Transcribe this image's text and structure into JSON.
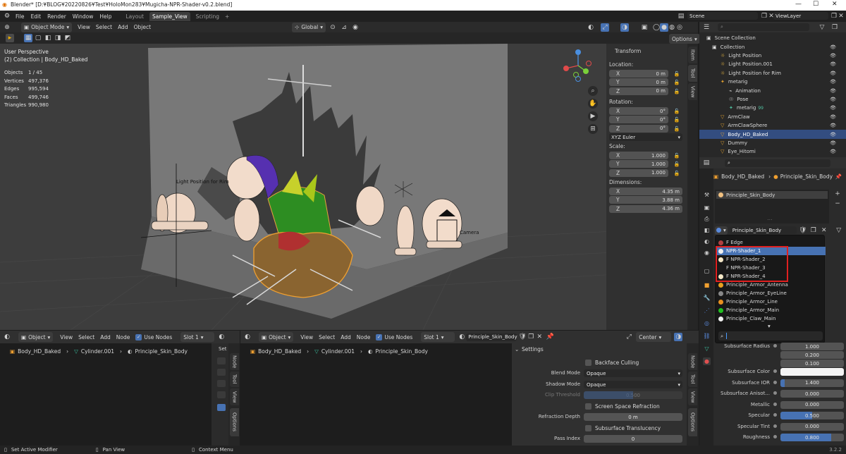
{
  "window": {
    "title": "Blender* [D:¥BLOG¥20220826¥Test¥HoloMon283¥Mugicha-NPR-Shader-v0.2.blend]"
  },
  "menu": [
    "File",
    "Edit",
    "Render",
    "Window",
    "Help"
  ],
  "workspaces": [
    "Layout",
    "Sample_View",
    "Scripting",
    "+"
  ],
  "scene": "Scene",
  "view_layer": "ViewLayer",
  "viewport": {
    "mode": "Object Mode",
    "menus": [
      "View",
      "Select",
      "Add",
      "Object"
    ],
    "transform_orientation": "Global",
    "options": "Options",
    "overlay_text": {
      "view": "User Perspective",
      "collection": "(2) Collection | Body_HD_Baked"
    },
    "stats": {
      "objects_label": "Objects",
      "objects": "1 / 45",
      "vertices_label": "Vertices",
      "vertices": "497,376",
      "edges_label": "Edges",
      "edges": "995,594",
      "faces_label": "Faces",
      "faces": "499,746",
      "triangles_label": "Triangles",
      "triangles": "990,980"
    },
    "labels": {
      "light_rim": "Light Position for Rim",
      "camera": "Camera"
    },
    "tabs": [
      "Item",
      "Tool",
      "View"
    ]
  },
  "npanel": {
    "title": "Transform",
    "location_label": "Location:",
    "location": [
      "0 m",
      "0 m",
      "0 m"
    ],
    "rotation_label": "Rotation:",
    "rotation": [
      "0°",
      "0°",
      "0°"
    ],
    "euler": "XYZ Euler",
    "scale_label": "Scale:",
    "scale": [
      "1.000",
      "1.000",
      "1.000"
    ],
    "dimensions_label": "Dimensions:",
    "dimensions": [
      "4.35 m",
      "3.88 m",
      "4.36 m"
    ],
    "axes": [
      "X",
      "Y",
      "Z"
    ]
  },
  "outliner": {
    "root": "Scene Collection",
    "items": [
      {
        "name": "Collection"
      },
      {
        "name": "Light Position"
      },
      {
        "name": "Light Position.001"
      },
      {
        "name": "Light Position for Rim"
      },
      {
        "name": "metarig"
      },
      {
        "name": "Animation"
      },
      {
        "name": "Pose"
      },
      {
        "name": "metarig",
        "badge": "99"
      },
      {
        "name": "ArmClaw"
      },
      {
        "name": "ArmClawSphere"
      },
      {
        "name": "Body_HD_Baked"
      },
      {
        "name": "Dummy"
      },
      {
        "name": "Eye_Hitomi"
      }
    ]
  },
  "properties": {
    "breadcrumb": [
      "Body_HD_Baked",
      "Principle_Skin_Body"
    ],
    "slot": "Principle_Skin_Body",
    "material_field": "Principle_Skin_Body",
    "dropdown": [
      {
        "name": "F Edge",
        "color": "#b04040"
      },
      {
        "name": "NPR-Shader_1",
        "color": "#f0f0f0",
        "selected": true
      },
      {
        "name": "F NPR-Shader_2",
        "color": "#f4e8c8"
      },
      {
        "name": "F NPR-Shader_3",
        "color": "#1a1a1a"
      },
      {
        "name": "F NPR-Shader_4",
        "color": "#f4e8c8"
      },
      {
        "name": "Principle_Armor_Antenna",
        "color": "#e8a020"
      },
      {
        "name": "Principle_Armor_EyeLine",
        "color": "#888888"
      },
      {
        "name": "Principle_Armor_Line",
        "color": "#e89020"
      },
      {
        "name": "Principle_Armor_Main",
        "color": "#20c020"
      },
      {
        "name": "Principle_Claw_Main",
        "color": "#f0f0f0"
      }
    ],
    "fields": [
      {
        "label": "Subsurface Radius",
        "value": "1.000"
      },
      {
        "label": "",
        "value": "0.200"
      },
      {
        "label": "",
        "value": "0.100"
      },
      {
        "label": "Subsurface Color",
        "value": ""
      },
      {
        "label": "Subsurface IOR",
        "value": "1.400"
      },
      {
        "label": "Subsurface Anisot...",
        "value": "0.000"
      },
      {
        "label": "Metallic",
        "value": "0.000"
      },
      {
        "label": "Specular",
        "value": "0.500"
      },
      {
        "label": "Specular Tint",
        "value": "0.000"
      },
      {
        "label": "Roughness",
        "value": "0.800"
      }
    ]
  },
  "shader1": {
    "object": "Object",
    "menus": [
      "View",
      "Select",
      "Add",
      "Node"
    ],
    "use_nodes": "Use Nodes",
    "slot": "Slot 1",
    "breadcrumb": [
      "Body_HD_Baked",
      "Cylinder.001",
      "Principle_Skin_Body"
    ],
    "tab_cut": "Set",
    "tabs": [
      "Node",
      "Tool",
      "View",
      "Options"
    ]
  },
  "shader2": {
    "object": "Object",
    "menus": [
      "View",
      "Select",
      "Add",
      "Node"
    ],
    "use_nodes": "Use Nodes",
    "slot": "Slot 1",
    "material": "Principle_Skin_Body",
    "pivot": "Center",
    "breadcrumb": [
      "Body_HD_Baked",
      "Cylinder.001",
      "Principle_Skin_Body"
    ],
    "tabs": [
      "Node",
      "Tool",
      "View",
      "Options"
    ],
    "settings": {
      "title": "Settings",
      "backface": "Backface Culling",
      "blend_label": "Blend Mode",
      "blend": "Opaque",
      "shadow_label": "Shadow Mode",
      "shadow": "Opaque",
      "clip_label": "Clip Threshold",
      "clip": "0.500",
      "ssr": "Screen Space Refraction",
      "refraction_label": "Refraction Depth",
      "refraction": "0 m",
      "translucency": "Subsurface Translucency",
      "pass_label": "Pass Index",
      "pass": "0"
    }
  },
  "status": {
    "left": "Set Active Modifier",
    "mid": "Pan View",
    "right": "Context Menu",
    "version": "3.2.2"
  }
}
